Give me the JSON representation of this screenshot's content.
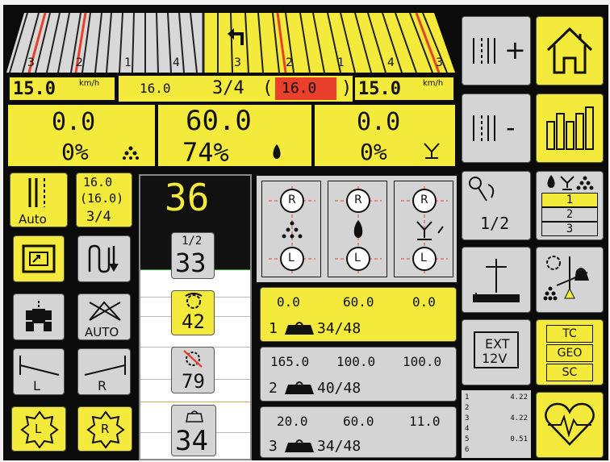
{
  "rows": {
    "left": [
      "3",
      "2",
      "1",
      "4"
    ],
    "center": [
      "3",
      "2",
      "1",
      "4",
      "3"
    ]
  },
  "speed": {
    "left_value": "15.0",
    "left_unit": "km/h",
    "right_value": "15.0",
    "right_unit": "km/h",
    "rate": "16.0",
    "fraction": "3/4",
    "open_paren": "(",
    "target": "16.0",
    "close_paren": ")"
  },
  "products": [
    {
      "value": "0.0",
      "percent": "0%",
      "icon": "fertilizer-icon"
    },
    {
      "value": "60.0",
      "percent": "74%",
      "icon": "seed-icon"
    },
    {
      "value": "0.0",
      "percent": "0%",
      "icon": "microgranulate-icon"
    }
  ],
  "left_buttons": {
    "auto_label": "Auto",
    "rate_top": "16.0",
    "rate_mid": "(16.0)",
    "rate_bottom": "3/4",
    "auto_steer_label": "AUTO",
    "left_marker": "L",
    "right_marker": "R",
    "left_lift": "L",
    "right_lift": "R"
  },
  "counter": {
    "main": "36",
    "half_label": "1/2",
    "half_value": "33",
    "rotor_value": "42",
    "blocked_value": "79",
    "hopper_value": "34"
  },
  "meter_labels": [
    "R",
    "L"
  ],
  "hoppers": [
    {
      "index": "1",
      "v1": "0.0",
      "v2": "60.0",
      "v3": "0.0",
      "fill": "34/48",
      "active": true
    },
    {
      "index": "2",
      "v1": "165.0",
      "v2": "100.0",
      "v3": "100.0",
      "fill": "40/48",
      "active": false
    },
    {
      "index": "3",
      "v1": "20.0",
      "v2": "60.0",
      "v3": "11.0",
      "fill": "34/48",
      "active": false
    }
  ],
  "right_buttons": {
    "plus": "+",
    "minus": "-",
    "half": "1/2",
    "tramline_rows": [
      "1",
      "2",
      "3"
    ],
    "ext_line1": "EXT",
    "ext_line2": "12V",
    "tc": "TC",
    "geo": "GEO",
    "sc": "SC"
  },
  "stats": [
    {
      "row": "1",
      "value": "4.22"
    },
    {
      "row": "2",
      "value": ""
    },
    {
      "row": "3",
      "value": "4.22"
    },
    {
      "row": "4",
      "value": ""
    },
    {
      "row": "5",
      "value": "0.51"
    },
    {
      "row": "6",
      "value": ""
    }
  ],
  "colors": {
    "yellow": "#f4ea3c",
    "gray": "#d4d4d4",
    "red": "#e8402a",
    "black": "#0b0b0b"
  }
}
